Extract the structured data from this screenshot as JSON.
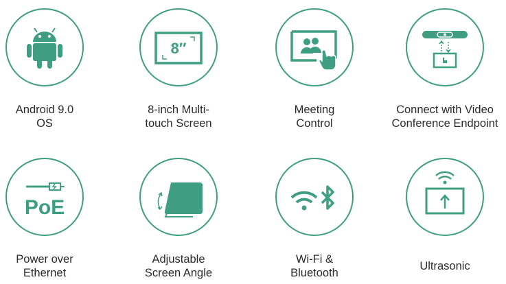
{
  "colors": {
    "accent": "#3f9e82",
    "text": "#2b2b2b",
    "background": "#ffffff"
  },
  "features": [
    {
      "icon": "android-icon",
      "label": "Android 9.0\nOS"
    },
    {
      "icon": "touch-screen-8-inch-icon",
      "label": "8-inch Multi-\ntouch Screen",
      "icon_text": "8″"
    },
    {
      "icon": "meeting-control-icon",
      "label": "Meeting\nControl"
    },
    {
      "icon": "video-conference-endpoint-icon",
      "label": "Connect with Video\nConference Endpoint"
    },
    {
      "icon": "poe-icon",
      "label": "Power over\nEthernet",
      "icon_text": "PoE"
    },
    {
      "icon": "adjustable-angle-icon",
      "label": "Adjustable\nScreen Angle"
    },
    {
      "icon": "wifi-bluetooth-icon",
      "label": "Wi-Fi &\nBluetooth"
    },
    {
      "icon": "ultrasonic-icon",
      "label": "Ultrasonic"
    }
  ]
}
